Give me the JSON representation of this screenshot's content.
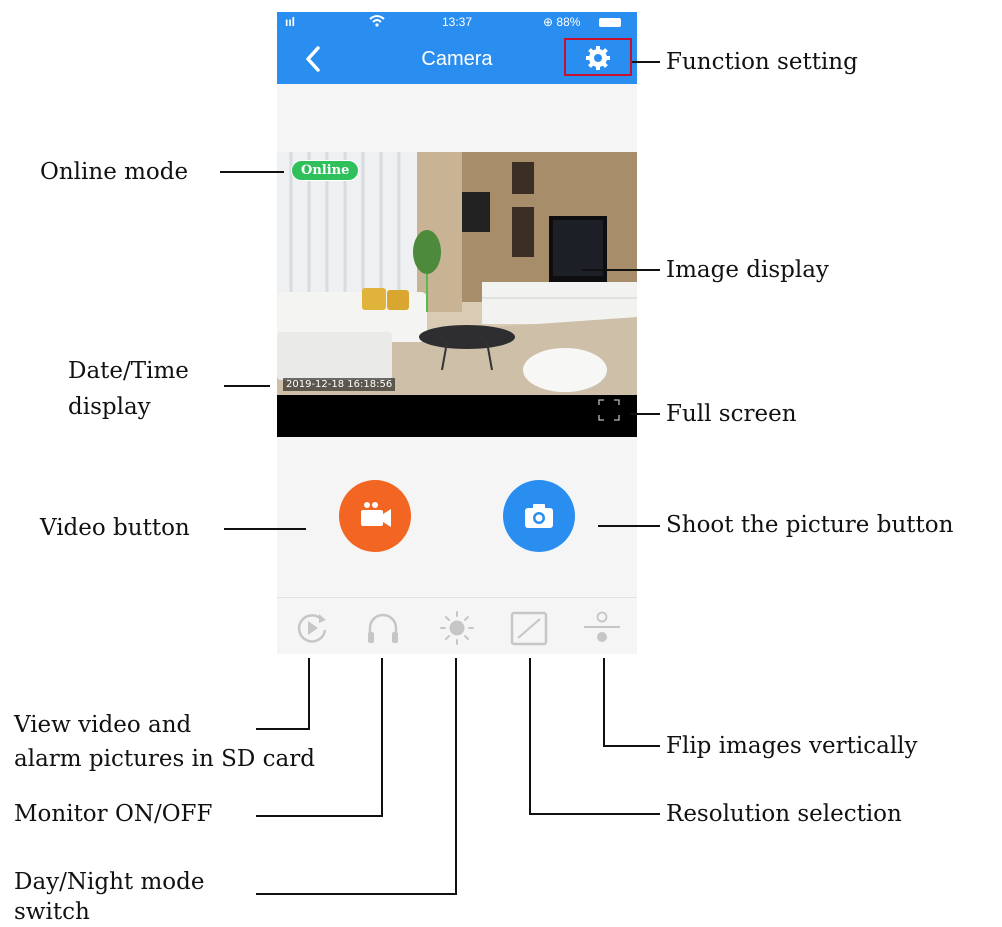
{
  "app": {
    "status_signal": "ııl",
    "status_time": "13:37",
    "status_battery": "⊕ 88%",
    "title": "Camera"
  },
  "overlay": {
    "online_badge": "Online",
    "datetime": "2019-12-18  16:18:56"
  },
  "icons": {
    "back": "chevron-left-icon",
    "settings": "gear-icon",
    "fullscreen": "fullscreen-icon",
    "video": "video-camera-icon",
    "photo": "camera-icon",
    "playback": "replay-icon",
    "monitor": "headphones-icon",
    "daynight": "sun-icon",
    "resolution": "resolution-icon",
    "flip": "flip-vertical-icon"
  },
  "colors": {
    "header_blue": "#2a8ef0",
    "video_orange": "#f26522",
    "online_green": "#2fc05c",
    "highlight_red": "#c8102e"
  },
  "labels": {
    "function_setting": "Function setting",
    "online_mode": "Online mode",
    "image_display": "Image display",
    "datetime_line1": "Date/Time",
    "datetime_line2": "display",
    "full_screen": "Full screen",
    "video_button": "Video button",
    "shoot_button": "Shoot  the picture button",
    "view_video_line1": "View video and",
    "view_video_line2": "alarm pictures in SD card",
    "monitor": "Monitor ON/OFF",
    "daynight_line1": "Day/Night mode",
    "daynight_line2": "switch",
    "flip": "Flip images vertically",
    "resolution": "Resolution selection"
  }
}
